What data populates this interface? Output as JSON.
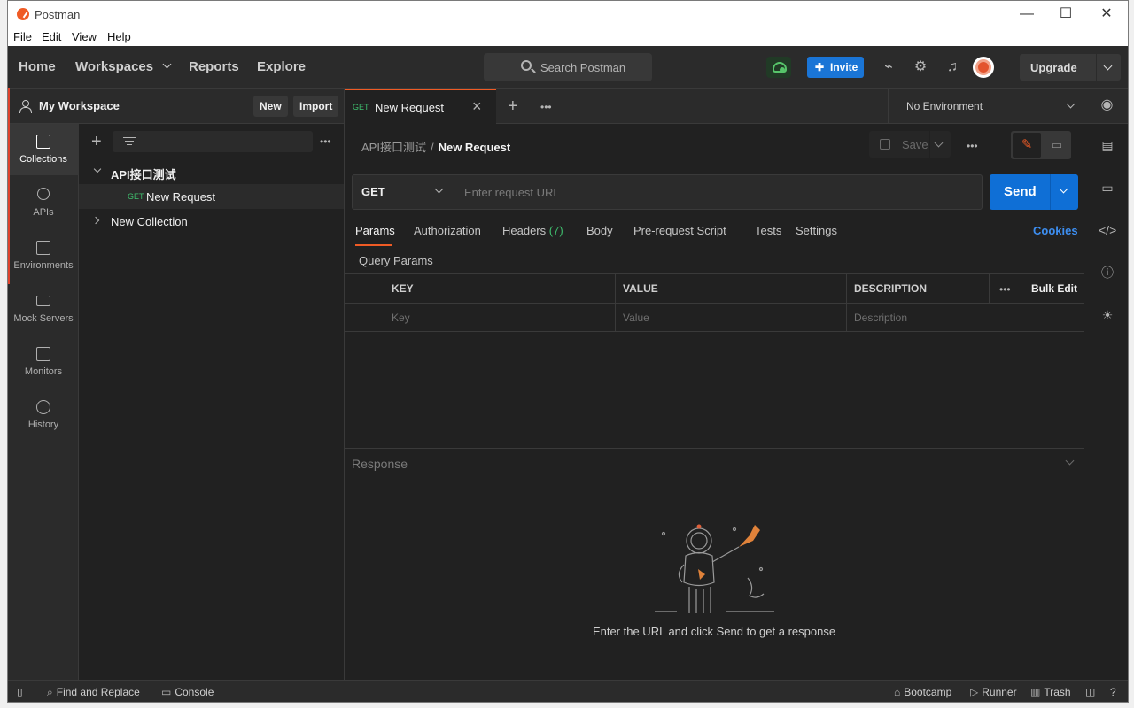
{
  "window": {
    "title": "Postman",
    "minimize": "—",
    "maximize": "☐",
    "close": "✕"
  },
  "menu": [
    "File",
    "Edit",
    "View",
    "Help"
  ],
  "header": {
    "nav": [
      "Home",
      "Workspaces",
      "Reports",
      "Explore"
    ],
    "search_placeholder": "Search Postman",
    "invite_label": "Invite",
    "upgrade_label": "Upgrade"
  },
  "workspace": {
    "title": "My Workspace",
    "new_label": "New",
    "import_label": "Import"
  },
  "rail": [
    "Collections",
    "APIs",
    "Environments",
    "Mock Servers",
    "Monitors",
    "History"
  ],
  "collections": {
    "items": [
      {
        "name": "API接口测试",
        "expanded": true,
        "requests": [
          {
            "method": "GET",
            "name": "New Request"
          }
        ]
      },
      {
        "name": "New Collection",
        "expanded": false
      }
    ]
  },
  "tabs": {
    "active": {
      "method": "GET",
      "name": "New Request"
    }
  },
  "environment": "No Environment",
  "request": {
    "breadcrumb": [
      "API接口测试",
      "New Request"
    ],
    "save_label": "Save",
    "method": "GET",
    "url_placeholder": "Enter request URL",
    "send_label": "Send",
    "tabs": [
      "Params",
      "Authorization",
      "Headers",
      "Body",
      "Pre-request Script",
      "Tests",
      "Settings"
    ],
    "headers_count": "(7)",
    "cookies_label": "Cookies",
    "query_params_label": "Query Params",
    "params_table": {
      "columns": [
        "KEY",
        "VALUE",
        "DESCRIPTION"
      ],
      "bulk_edit": "Bulk Edit",
      "placeholders": [
        "Key",
        "Value",
        "Description"
      ]
    }
  },
  "response": {
    "label": "Response",
    "empty_message": "Enter the URL and click Send to get a response"
  },
  "statusbar": {
    "find_replace": "Find and Replace",
    "console": "Console",
    "bootcamp": "Bootcamp",
    "runner": "Runner",
    "trash": "Trash"
  },
  "colors": {
    "accent": "#ef5b25",
    "primary_blue": "#0f6fd6",
    "get_green": "#3fbf6e"
  }
}
